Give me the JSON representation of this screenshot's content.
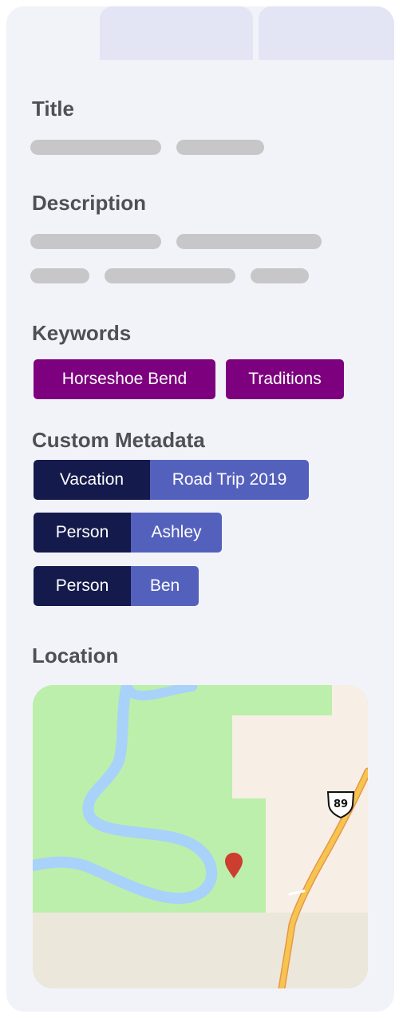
{
  "tabs": [
    {
      "label": "",
      "active": true
    },
    {
      "label": "",
      "active": false
    },
    {
      "label": "",
      "active": false
    }
  ],
  "title_section": {
    "heading": "Title"
  },
  "description_section": {
    "heading": "Description"
  },
  "keywords_section": {
    "heading": "Keywords",
    "keywords": [
      "Horseshoe Bend",
      "Traditions"
    ]
  },
  "custom_metadata_section": {
    "heading": "Custom Metadata",
    "entries": [
      {
        "key": "Vacation",
        "value": "Road Trip 2019"
      },
      {
        "key": "Person",
        "value": "Ashley"
      },
      {
        "key": "Person",
        "value": "Ben"
      }
    ]
  },
  "location_section": {
    "heading": "Location",
    "map": {
      "highway_shield": "89"
    }
  },
  "colors": {
    "panel_bg": "#f2f3f9",
    "inactive_tab": "#e3e5f4",
    "keyword_chip": "#7d007f",
    "metadata_key": "#141a4b",
    "metadata_value": "#5461bc",
    "skeleton": "#c7c7c9",
    "map_park": "#bcefab",
    "map_water": "#a8d2f9",
    "map_land": "#f7efe6",
    "map_road": "#f5c54f",
    "map_pin": "#cc3e30"
  },
  "icons": [
    "map-pin-icon",
    "highway-shield-icon"
  ]
}
